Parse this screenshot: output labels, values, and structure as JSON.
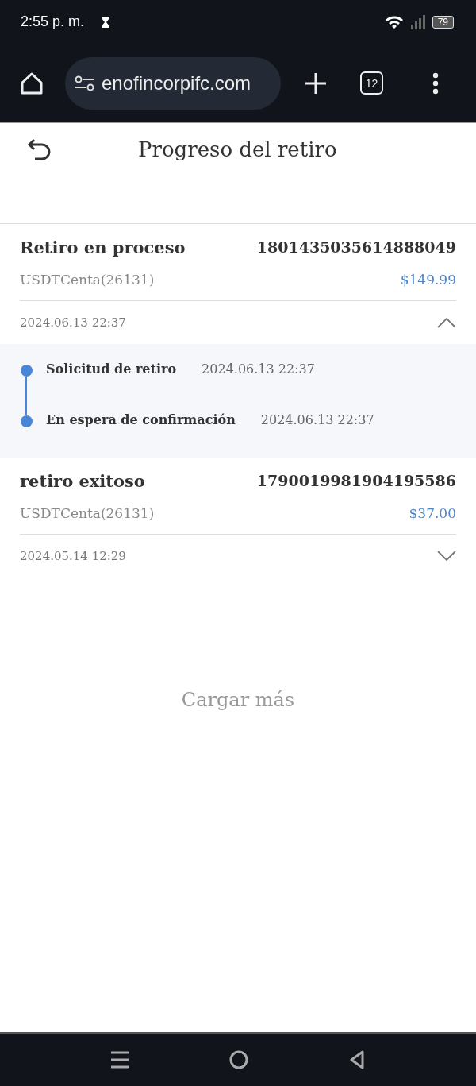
{
  "status_bar": {
    "time": "2:55 p. m.",
    "battery": "79"
  },
  "browser": {
    "url": "enofincorpifc.com",
    "tab_count": "12"
  },
  "header": {
    "title": "Progreso del retiro"
  },
  "records": [
    {
      "status": "Retiro en proceso",
      "id": "1801435035614888049",
      "account": "USDTCenta(26131)",
      "amount": "$149.99",
      "date": "2024.06.13 22:37",
      "expanded": true,
      "steps": [
        {
          "label": "Solicitud de retiro",
          "time": "2024.06.13 22:37"
        },
        {
          "label": "En espera de confirmación",
          "time": "2024.06.13 22:37"
        }
      ]
    },
    {
      "status": "retiro exitoso",
      "id": "1790019981904195586",
      "account": "USDTCenta(26131)",
      "amount": "$37.00",
      "date": "2024.05.14 12:29",
      "expanded": false
    }
  ],
  "load_more": "Cargar más"
}
